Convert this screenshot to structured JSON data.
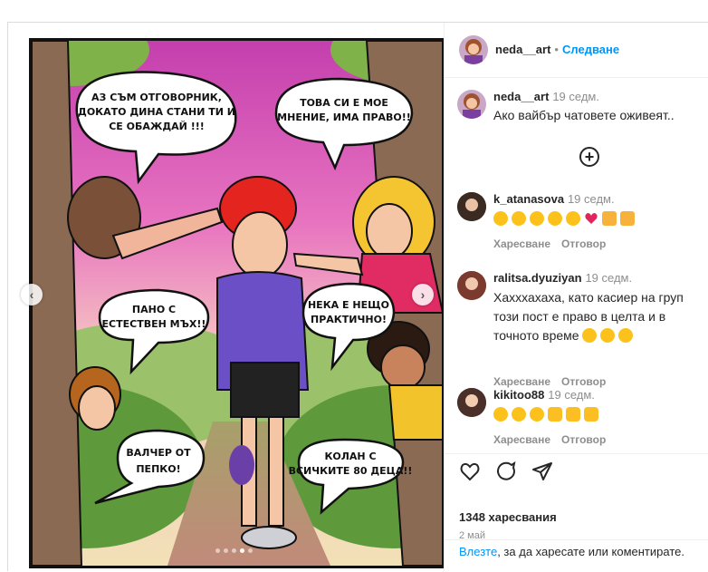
{
  "post": {
    "author": "neda__art",
    "follow_label": "Следване",
    "caption_time": "19 седм.",
    "caption": "Ако вайбър чатовете оживеят..",
    "likes": "1348 харесвания",
    "date": "2 май",
    "login_link": "Влезте",
    "login_text": ", за да харесате или коментирате."
  },
  "comic": {
    "bubbles": [
      {
        "text": "АЗ СЪМ ОТГОВОРНИК, ДОКАТО ДИНА СТАНИ ТИ И СЕ ОБАЖДАЙ !!!"
      },
      {
        "text": "ТОВА СИ Е МОЕ МНЕНИЕ, ИМА ПРАВО!!"
      },
      {
        "text": "ПАНО С ЕСТЕСТВЕН МЪХ!!"
      },
      {
        "text": "НЕКА Е НЕЩО ПРАКТИЧНО!"
      },
      {
        "text": "ВАЛЧЕР ОТ ПЕПКО!"
      },
      {
        "text": "КОЛАН С ВСИЧКИТЕ 80 ДЕЦА!!"
      }
    ]
  },
  "comments": [
    {
      "user": "k_atanasova",
      "time": "19 седм.",
      "lines": [
        ""
      ],
      "emoji": [
        "joy",
        "joy",
        "joy",
        "joy",
        "joy",
        "heart",
        "hands",
        "hands"
      ],
      "like": "Харесване",
      "reply": "Отговор"
    },
    {
      "user": "ralitsa.dyuziyan",
      "time": "19 седм.",
      "lines": [
        "Хахххахаха, като касиер на груп",
        "този пост е право в целта и в",
        "точното време"
      ],
      "emoji": [
        "joy",
        "joy",
        "joy"
      ],
      "like": "Харесване",
      "reply": "Отговор"
    },
    {
      "user": "kikitoo88",
      "time": "19 седм.",
      "lines": [
        ""
      ],
      "emoji": [
        "joy",
        "joy",
        "joy",
        "clap",
        "clap",
        "clap"
      ],
      "like": "Харесване",
      "reply": "Отговор"
    }
  ],
  "icons": {
    "like": "heart-outline-icon",
    "comment": "comment-icon",
    "share": "paper-plane-icon",
    "more": "plus-circle-icon"
  },
  "colors": {
    "accent": "#0095f6",
    "text": "#262626",
    "muted": "#8e8e8e"
  }
}
